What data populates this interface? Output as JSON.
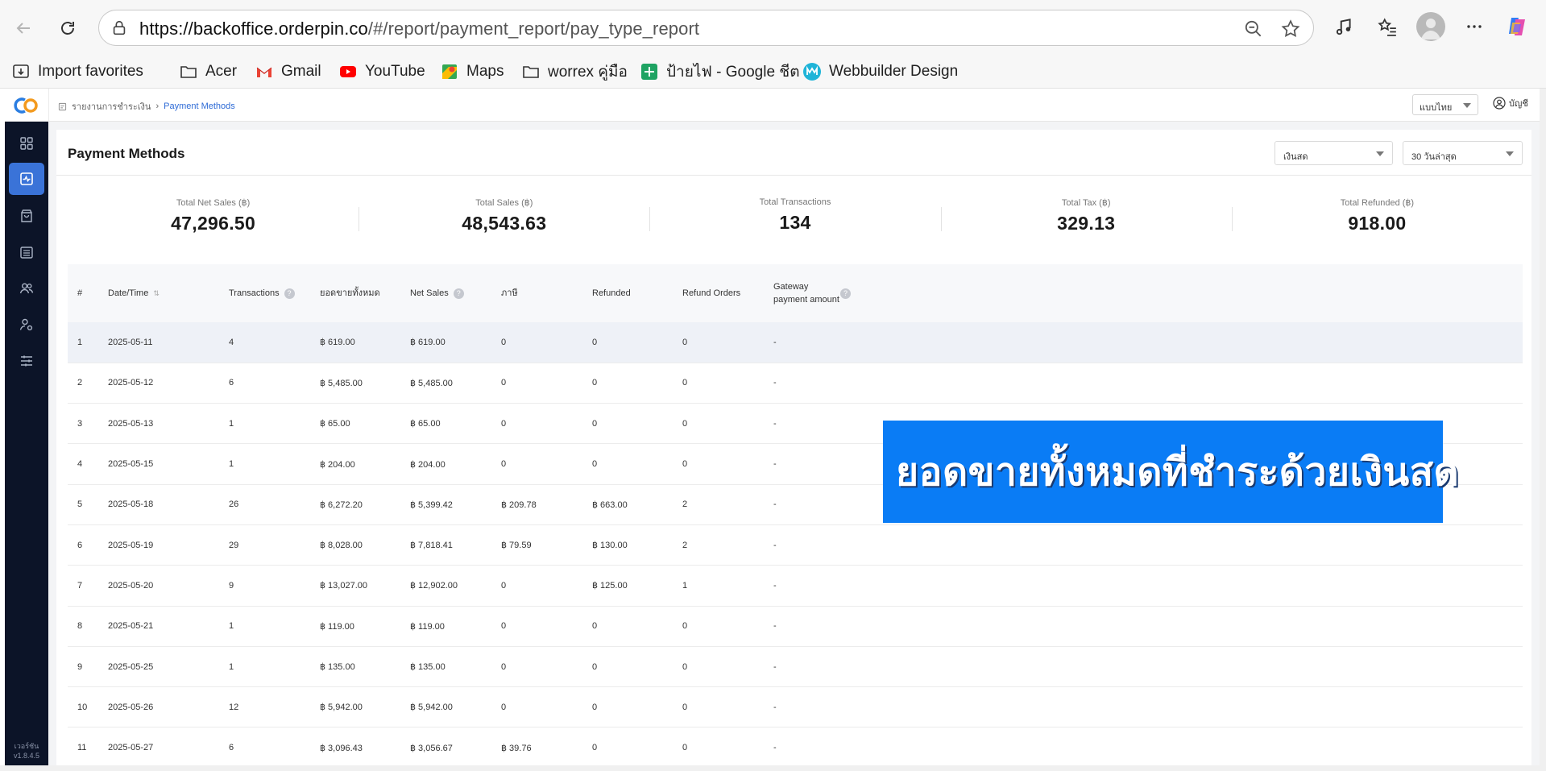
{
  "browser": {
    "url_host": "https://backoffice.orderpin.co",
    "url_path": "/#/report/payment_report/pay_type_report",
    "bookmarks": [
      {
        "label": "Import favorites",
        "icon": "import-icon"
      },
      {
        "label": "Acer",
        "icon": "folder-icon"
      },
      {
        "label": "Gmail",
        "icon": "gmail-icon"
      },
      {
        "label": "YouTube",
        "icon": "youtube-icon"
      },
      {
        "label": "Maps",
        "icon": "maps-icon"
      },
      {
        "label": "worrex คู่มือ",
        "icon": "folder-icon"
      },
      {
        "label": "ป้ายไฟ - Google ชีต",
        "icon": "sheets-icon"
      },
      {
        "label": "Webbuilder Design",
        "icon": "webbuilder-icon"
      }
    ]
  },
  "header": {
    "breadcrumb_parent": "รายงานการชำระเงิน",
    "breadcrumb_current": "Payment Methods",
    "language": "แบบไทย",
    "account": "บัญชี"
  },
  "sidebar": {
    "items": [
      "dashboard-icon",
      "report-icon",
      "bag-icon",
      "store-icon",
      "users-icon",
      "user-settings-icon",
      "sliders-icon"
    ],
    "version_label": "เวอร์ชัน",
    "version": "v1.8.4.5"
  },
  "page": {
    "title": "Payment Methods",
    "payment_type": "เงินสด",
    "date_range": "30 วันล่าสุด"
  },
  "stats": [
    {
      "label": "Total Net Sales (฿)",
      "value": "47,296.50"
    },
    {
      "label": "Total Sales (฿)",
      "value": "48,543.63"
    },
    {
      "label": "Total Transactions",
      "value": "134"
    },
    {
      "label": "Total Tax (฿)",
      "value": "329.13"
    },
    {
      "label": "Total Refunded (฿)",
      "value": "918.00"
    }
  ],
  "table": {
    "headers": [
      "#",
      "Date/Time",
      "Transactions",
      "ยอดขายทั้งหมด",
      "Net Sales",
      "ภาษี",
      "Refunded",
      "Refund Orders",
      "Gateway payment amount"
    ],
    "rows": [
      [
        "1",
        "2025-05-11",
        "4",
        "฿ 619.00",
        "฿ 619.00",
        "0",
        "0",
        "0",
        "-"
      ],
      [
        "2",
        "2025-05-12",
        "6",
        "฿ 5,485.00",
        "฿ 5,485.00",
        "0",
        "0",
        "0",
        "-"
      ],
      [
        "3",
        "2025-05-13",
        "1",
        "฿ 65.00",
        "฿ 65.00",
        "0",
        "0",
        "0",
        "-"
      ],
      [
        "4",
        "2025-05-15",
        "1",
        "฿ 204.00",
        "฿ 204.00",
        "0",
        "0",
        "0",
        "-"
      ],
      [
        "5",
        "2025-05-18",
        "26",
        "฿ 6,272.20",
        "฿ 5,399.42",
        "฿ 209.78",
        "฿ 663.00",
        "2",
        "-"
      ],
      [
        "6",
        "2025-05-19",
        "29",
        "฿ 8,028.00",
        "฿ 7,818.41",
        "฿ 79.59",
        "฿ 130.00",
        "2",
        "-"
      ],
      [
        "7",
        "2025-05-20",
        "9",
        "฿ 13,027.00",
        "฿ 12,902.00",
        "0",
        "฿ 125.00",
        "1",
        "-"
      ],
      [
        "8",
        "2025-05-21",
        "1",
        "฿ 119.00",
        "฿ 119.00",
        "0",
        "0",
        "0",
        "-"
      ],
      [
        "9",
        "2025-05-25",
        "1",
        "฿ 135.00",
        "฿ 135.00",
        "0",
        "0",
        "0",
        "-"
      ],
      [
        "10",
        "2025-05-26",
        "12",
        "฿ 5,942.00",
        "฿ 5,942.00",
        "0",
        "0",
        "0",
        "-"
      ],
      [
        "11",
        "2025-05-27",
        "6",
        "฿ 3,096.43",
        "฿ 3,056.67",
        "฿ 39.76",
        "0",
        "0",
        "-"
      ]
    ]
  },
  "overlay_text": "ยอดขายทั้งหมดที่ชำระด้วยเงินสด"
}
